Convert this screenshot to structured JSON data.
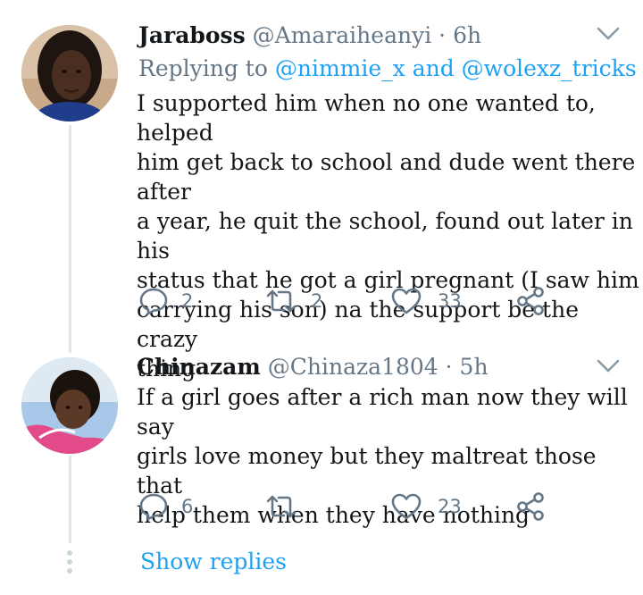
{
  "tweets": [
    {
      "display_name": "Jaraboss",
      "handle": "@Amaraiheanyi",
      "separator": "·",
      "time": "6h",
      "replying_prefix": "Replying to",
      "replying_mention_1": "@nimmie_x",
      "replying_and": "and",
      "replying_mention_2": "@wolexz_tricks",
      "text": "I supported him when no one wanted to, helped\nhim get back to school and dude went there after\na year, he quit the school, found out later in his\nstatus that he got a girl pregnant (I saw him\ncarrying his son) na the support be the crazy\nthing",
      "replies": "2",
      "retweets": "2",
      "likes": "33"
    },
    {
      "display_name": "Chinazam",
      "handle": "@Chinaza1804",
      "separator": "·",
      "time": "5h",
      "text": "If a girl goes after a rich man now they will say\ngirls love money but they maltreat those that\nhelp them when they have nothing",
      "replies": "6",
      "likes": "23"
    }
  ],
  "show_replies": "Show replies",
  "icons": {
    "reply": "reply-icon",
    "retweet": "retweet-icon",
    "like": "heart-icon",
    "share": "share-icon",
    "menu": "chevron-down-icon"
  },
  "colors": {
    "text": "#14171a",
    "secondary": "#657786",
    "link": "#1da1f2",
    "thread_line": "#e1e8ed"
  }
}
